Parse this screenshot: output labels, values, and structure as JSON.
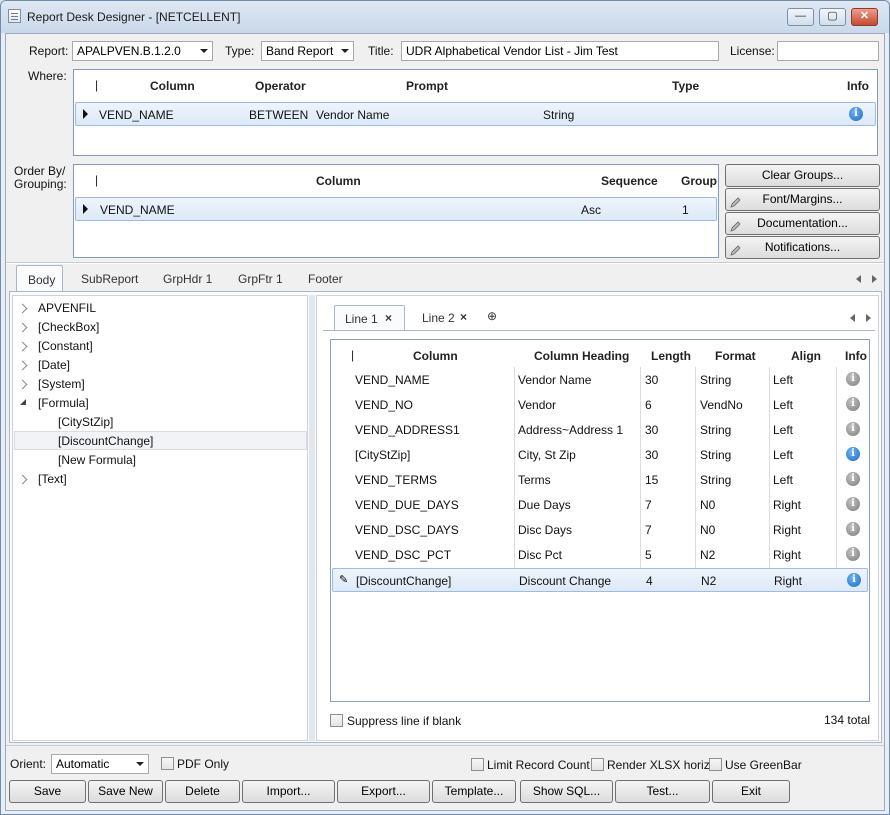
{
  "window": {
    "title": "Report Desk Designer - [NETCELLENT]",
    "min": "—",
    "max": "▢",
    "close": "✕"
  },
  "header": {
    "report_label": "Report:",
    "report_value": "APALPVEN.B.1.2.0",
    "type_label": "Type:",
    "type_value": "Band Report",
    "title_label": "Title:",
    "title_value": "UDR Alphabetical Vendor List - Jim Test",
    "license_label": "License:",
    "license_value": ""
  },
  "where": {
    "label": "Where:",
    "columns": [
      "Column",
      "Operator",
      "Prompt",
      "Type",
      "Info"
    ],
    "rows": [
      {
        "column": "VEND_NAME",
        "operator": "BETWEEN",
        "prompt": "Vendor Name",
        "type": "String"
      }
    ]
  },
  "orderby": {
    "label1": "Order By/",
    "label2": "Grouping:",
    "columns": [
      "Column",
      "Sequence",
      "Group"
    ],
    "rows": [
      {
        "column": "VEND_NAME",
        "sequence": "Asc",
        "group": "1"
      }
    ]
  },
  "side_buttons": {
    "clear_groups": "Clear Groups...",
    "font_margins": "Font/Margins...",
    "documentation": "Documentation...",
    "notifications": "Notifications..."
  },
  "section_tabs": [
    "Body",
    "SubReport",
    "GrpHdr 1",
    "GrpFtr 1",
    "Footer"
  ],
  "tree": {
    "items": [
      "APVENFIL",
      "[CheckBox]",
      "[Constant]",
      "[Date]",
      "[System]",
      "[Formula]",
      "[CityStZip]",
      "[DiscountChange]",
      "[New Formula]",
      "[Text]"
    ]
  },
  "line_tabs": {
    "tab1": "Line 1",
    "tab2": "Line 2",
    "close": "×",
    "add": "⊕"
  },
  "lines_grid": {
    "columns": [
      "Column",
      "Column Heading",
      "Length",
      "Format",
      "Align",
      "Info"
    ],
    "rows": [
      {
        "column": "VEND_NAME",
        "heading": "Vendor Name",
        "length": "30",
        "format": "String",
        "align": "Left"
      },
      {
        "column": "VEND_NO",
        "heading": "Vendor",
        "length": "6",
        "format": "VendNo",
        "align": "Left"
      },
      {
        "column": "VEND_ADDRESS1",
        "heading": "Address~Address 1",
        "length": "30",
        "format": "String",
        "align": "Left"
      },
      {
        "column": "[CityStZip]",
        "heading": "City, St Zip",
        "length": "30",
        "format": "String",
        "align": "Left"
      },
      {
        "column": "VEND_TERMS",
        "heading": "Terms",
        "length": "15",
        "format": "String",
        "align": "Left"
      },
      {
        "column": "VEND_DUE_DAYS",
        "heading": "Due Days",
        "length": "7",
        "format": "N0",
        "align": "Right"
      },
      {
        "column": "VEND_DSC_DAYS",
        "heading": "Disc Days",
        "length": "7",
        "format": "N0",
        "align": "Right"
      },
      {
        "column": "VEND_DSC_PCT",
        "heading": "Disc Pct",
        "length": "5",
        "format": "N2",
        "align": "Right"
      },
      {
        "column": "[DiscountChange]",
        "heading": "Discount Change",
        "length": "4",
        "format": "N2",
        "align": "Right"
      }
    ]
  },
  "line_footer": {
    "suppress": "Suppress line if blank",
    "total": "134 total"
  },
  "options": {
    "orient_label": "Orient:",
    "orient_value": "Automatic",
    "pdf_only": "PDF Only",
    "limit_record": "Limit Record Count",
    "render_xlsx": "Render XLSX horiz.",
    "use_greenbar": "Use GreenBar"
  },
  "bottom_buttons": {
    "save": "Save",
    "save_new": "Save New",
    "delete": "Delete",
    "import": "Import...",
    "export": "Export...",
    "template": "Template...",
    "show_sql": "Show SQL...",
    "test": "Test...",
    "exit": "Exit"
  },
  "icons": {
    "info": "i",
    "edit": "✎"
  },
  "colors": {
    "accent": "#1c6ac9",
    "selection": "#dde9f8"
  }
}
